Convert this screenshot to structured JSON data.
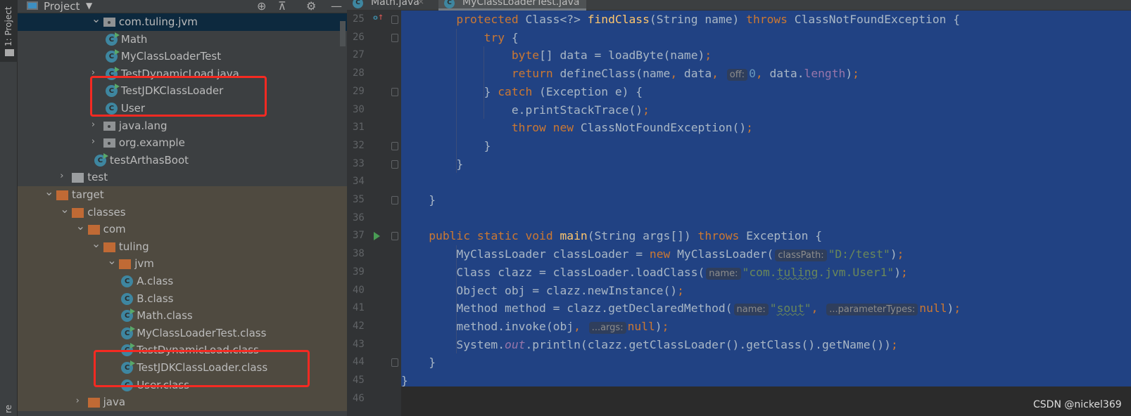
{
  "tool_strip": {
    "project_label": "1: Project",
    "bottom_label": "re"
  },
  "project_panel": {
    "title": "Project",
    "tree": [
      {
        "label": "com.tuling.jvm",
        "level": 3,
        "icon": "package-icon",
        "expand": "open",
        "selected": true
      },
      {
        "label": "Math",
        "level": 4,
        "icon": "class-run-icon"
      },
      {
        "label": "MyClassLoaderTest",
        "level": 4,
        "icon": "class-run-icon"
      },
      {
        "label": "TestDynamicLoad.java",
        "level": 4,
        "icon": "class-run-icon",
        "expand": "closed",
        "chevron_level": 3
      },
      {
        "label": "TestJDKClassLoader",
        "level": 4,
        "icon": "class-run-icon"
      },
      {
        "label": "User",
        "level": 4,
        "icon": "class-icon"
      },
      {
        "label": "java.lang",
        "level": 3,
        "icon": "package-icon",
        "expand": "closed"
      },
      {
        "label": "org.example",
        "level": 3,
        "icon": "package-icon",
        "expand": "closed"
      },
      {
        "label": "testArthasBoot",
        "level": 3,
        "icon": "class-run-icon",
        "leaf_at_chevron": true
      },
      {
        "label": "test",
        "level": 1,
        "icon": "folder-icon",
        "expand": "closed"
      },
      {
        "label": "target",
        "level": 0,
        "icon": "excluded-folder-icon",
        "expand": "open",
        "excluded": true
      },
      {
        "label": "classes",
        "level": 1,
        "icon": "excluded-folder-icon",
        "expand": "open",
        "excluded": true
      },
      {
        "label": "com",
        "level": 2,
        "icon": "excluded-folder-icon",
        "expand": "open",
        "excluded": true
      },
      {
        "label": "tuling",
        "level": 3,
        "icon": "excluded-folder-icon",
        "expand": "open",
        "excluded": true
      },
      {
        "label": "jvm",
        "level": 4,
        "icon": "excluded-folder-icon",
        "expand": "open",
        "excluded": true
      },
      {
        "label": "A.class",
        "level": 5,
        "icon": "class-icon",
        "excluded": true
      },
      {
        "label": "B.class",
        "level": 5,
        "icon": "class-icon",
        "excluded": true
      },
      {
        "label": "Math.class",
        "level": 5,
        "icon": "class-run-icon",
        "excluded": true
      },
      {
        "label": "MyClassLoaderTest.class",
        "level": 5,
        "icon": "class-run-icon",
        "excluded": true
      },
      {
        "label": "TestDynamicLoad.class",
        "level": 5,
        "icon": "class-run-icon",
        "excluded": true
      },
      {
        "label": "TestJDKClassLoader.class",
        "level": 5,
        "icon": "class-run-icon",
        "excluded": true
      },
      {
        "label": "User.class",
        "level": 5,
        "icon": "class-icon",
        "excluded": true
      },
      {
        "label": "java",
        "level": 2,
        "icon": "excluded-folder-icon",
        "expand": "closed",
        "excluded": true
      }
    ]
  },
  "editor": {
    "tabs": [
      {
        "label": "Math.java",
        "active": false
      },
      {
        "label": "MyClassLoaderTest.java",
        "active": true
      }
    ],
    "selection_color": "#214283",
    "lines": [
      {
        "n": "25",
        "marker": "override",
        "fold": true,
        "tokens": [
          [
            "        ",
            ""
          ],
          [
            "protected",
            "k"
          ],
          [
            " Class<?> ",
            ""
          ],
          [
            "findClass",
            "f"
          ],
          [
            "(String name) ",
            ""
          ],
          [
            "throws",
            "k"
          ],
          [
            " ClassNotFoundException {",
            ""
          ]
        ]
      },
      {
        "n": "26",
        "fold": true,
        "tokens": [
          [
            "            ",
            ""
          ],
          [
            "try",
            "k"
          ],
          [
            " {",
            ""
          ]
        ]
      },
      {
        "n": "27",
        "tokens": [
          [
            "                ",
            ""
          ],
          [
            "byte",
            "k"
          ],
          [
            "[] data = loadByte(name)",
            ""
          ],
          [
            ";",
            "k"
          ]
        ]
      },
      {
        "n": "28",
        "tokens": [
          [
            "                ",
            ""
          ],
          [
            "return",
            "k"
          ],
          [
            " defineClass(name",
            ""
          ],
          [
            ",",
            "k"
          ],
          [
            " data",
            ""
          ],
          [
            ",",
            "k"
          ],
          [
            " ",
            ""
          ],
          [
            "off:",
            "h"
          ],
          [
            "0",
            "n"
          ],
          [
            ",",
            "k"
          ],
          [
            " data.",
            ""
          ],
          [
            "length",
            "p"
          ],
          [
            ")",
            ""
          ],
          [
            ";",
            "k"
          ]
        ]
      },
      {
        "n": "29",
        "fold": true,
        "tokens": [
          [
            "            } ",
            ""
          ],
          [
            "catch",
            "k"
          ],
          [
            " (Exception e) {",
            ""
          ]
        ]
      },
      {
        "n": "30",
        "tokens": [
          [
            "                e.printStackTrace()",
            ""
          ],
          [
            ";",
            "k"
          ]
        ]
      },
      {
        "n": "31",
        "tokens": [
          [
            "                ",
            ""
          ],
          [
            "throw new",
            "k"
          ],
          [
            " ClassNotFoundException()",
            ""
          ],
          [
            ";",
            "k"
          ]
        ]
      },
      {
        "n": "32",
        "fold": true,
        "tokens": [
          [
            "            }",
            ""
          ]
        ]
      },
      {
        "n": "33",
        "fold": true,
        "tokens": [
          [
            "        }",
            ""
          ]
        ]
      },
      {
        "n": "34",
        "tokens": []
      },
      {
        "n": "35",
        "fold": true,
        "tokens": [
          [
            "    }",
            ""
          ]
        ]
      },
      {
        "n": "36",
        "tokens": []
      },
      {
        "n": "37",
        "marker": "run",
        "fold": true,
        "tokens": [
          [
            "    ",
            ""
          ],
          [
            "public static void",
            "k"
          ],
          [
            " ",
            ""
          ],
          [
            "main",
            "f"
          ],
          [
            "(String args[]) ",
            ""
          ],
          [
            "throws",
            "k"
          ],
          [
            " Exception {",
            ""
          ]
        ]
      },
      {
        "n": "38",
        "tokens": [
          [
            "        MyClassLoader classLoader = ",
            ""
          ],
          [
            "new",
            "k"
          ],
          [
            " MyClassLoader(",
            ""
          ],
          [
            "classPath:",
            "h"
          ],
          [
            "\"D:/test\"",
            "s"
          ],
          [
            ")",
            ""
          ],
          [
            ";",
            "k"
          ]
        ]
      },
      {
        "n": "39",
        "tokens": [
          [
            "        Class clazz = classLoader.loadClass(",
            ""
          ],
          [
            "name:",
            "h"
          ],
          [
            "\"com.",
            "s"
          ],
          [
            "tuling",
            "su"
          ],
          [
            ".jvm.User1\"",
            "s"
          ],
          [
            ")",
            ""
          ],
          [
            ";",
            "k"
          ]
        ]
      },
      {
        "n": "40",
        "tokens": [
          [
            "        Object obj = clazz.newInstance()",
            ""
          ],
          [
            ";",
            "k"
          ]
        ]
      },
      {
        "n": "41",
        "tokens": [
          [
            "        Method method = clazz.getDeclaredMethod(",
            ""
          ],
          [
            "name:",
            "h"
          ],
          [
            "\"",
            "s"
          ],
          [
            "sout",
            "su"
          ],
          [
            "\"",
            "s"
          ],
          [
            ",",
            "k"
          ],
          [
            " ",
            ""
          ],
          [
            "...parameterTypes:",
            "h"
          ],
          [
            "null",
            "k"
          ],
          [
            ")",
            ""
          ],
          [
            ";",
            "k"
          ]
        ]
      },
      {
        "n": "42",
        "tokens": [
          [
            "        method.invoke(obj",
            ""
          ],
          [
            ",",
            "k"
          ],
          [
            " ",
            ""
          ],
          [
            "...args:",
            "h"
          ],
          [
            "null",
            "k"
          ],
          [
            ")",
            ""
          ],
          [
            ";",
            "k"
          ]
        ]
      },
      {
        "n": "43",
        "tokens": [
          [
            "        System.",
            ""
          ],
          [
            "out",
            "i"
          ],
          [
            ".println(clazz.getClassLoader().getClass().getName())",
            ""
          ],
          [
            ";",
            "k"
          ]
        ]
      },
      {
        "n": "44",
        "fold": true,
        "tokens": [
          [
            "    }",
            ""
          ]
        ]
      },
      {
        "n": "45",
        "tokens": [
          [
            "}",
            ""
          ]
        ]
      },
      {
        "n": "46",
        "tokens": []
      }
    ]
  },
  "annotation_color": "#f52a22",
  "watermark": "CSDN @nickel369"
}
